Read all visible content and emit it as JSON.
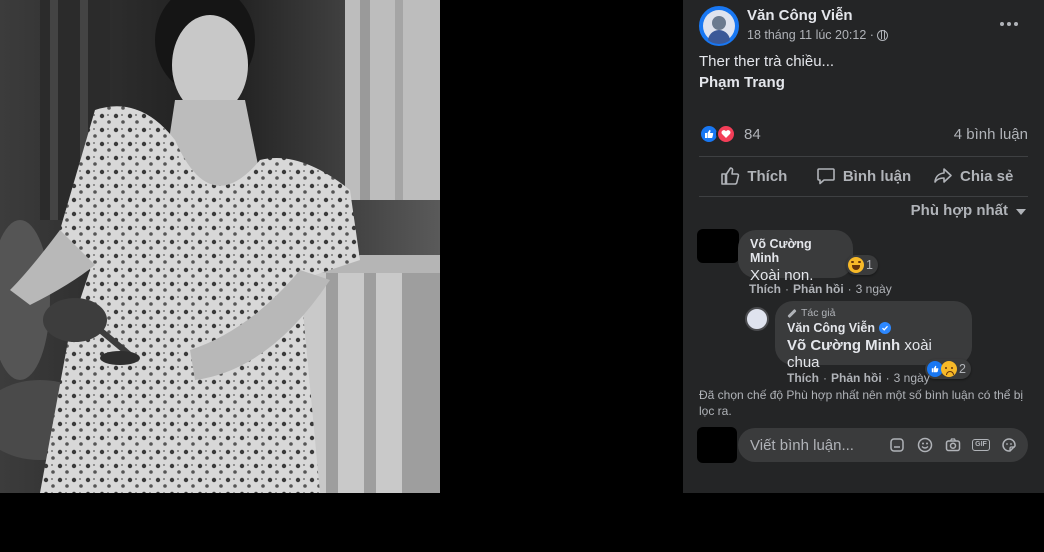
{
  "post": {
    "author": "Văn Công Viễn",
    "timestamp": "18 tháng 11 lúc 20:12 ·",
    "privacy_icon": "globe-icon",
    "text": "Ther ther trà chiều...",
    "tagged": "Phạm Trang",
    "reaction_count": "84",
    "comment_count": "4 bình luận"
  },
  "actions": {
    "like": "Thích",
    "comment": "Bình luận",
    "share": "Chia sẻ"
  },
  "sort": {
    "label": "Phù hợp nhất"
  },
  "comments": [
    {
      "name": "Võ Cường Minh",
      "text": "Xoài non.",
      "reaction_count": "1",
      "like": "Thích",
      "reply": "Phản hồi",
      "time": "3 ngày"
    },
    {
      "author_tag": "Tác giả",
      "name": "Văn Công Viễn",
      "mention": "Võ Cường Minh",
      "text": "xoài chua",
      "reaction_count": "2",
      "like": "Thích",
      "reply": "Phản hồi",
      "time": "3 ngày"
    }
  ],
  "filter_note": "Đã chọn chế độ Phù hợp nhất nên một số bình luận có thể bị lọc ra.",
  "composer": {
    "placeholder": "Viết bình luận..."
  },
  "colors": {
    "panel_bg": "#242526",
    "bubble_bg": "#3a3b3c",
    "text_primary": "#e4e6eb",
    "text_secondary": "#b0b3b8",
    "accent_blue": "#1877f2",
    "love_red": "#f33e58"
  }
}
